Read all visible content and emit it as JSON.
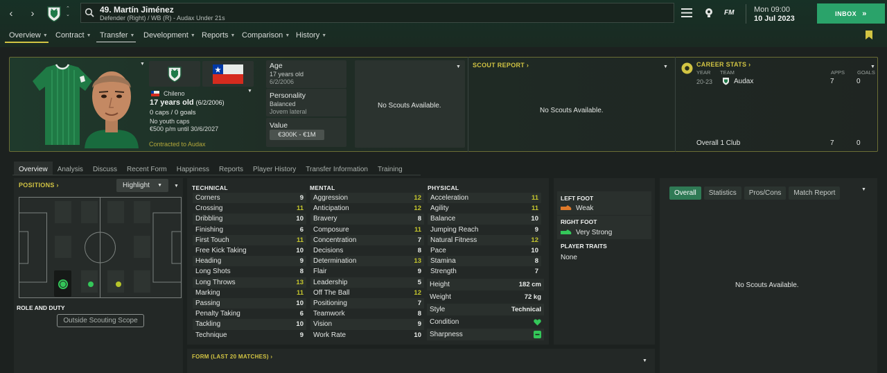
{
  "header": {
    "player_name": "49. Martín Jiménez",
    "player_sub": "Defender (Right) / WB (R) - Audax Under 21s",
    "date_day": "Mon 09:00",
    "date_full": "10 Jul 2023",
    "inbox_label": "INBOX",
    "fm_label": "FM"
  },
  "menu": {
    "items": [
      {
        "label": "Overview"
      },
      {
        "label": "Contract"
      },
      {
        "label": "Transfer"
      },
      {
        "label": "Development"
      },
      {
        "label": "Reports"
      },
      {
        "label": "Comparison"
      },
      {
        "label": "History"
      }
    ]
  },
  "profile": {
    "nationality": "Chileno",
    "age_line_bold": "17 years old",
    "age_line_rest": "(6/2/2006)",
    "caps": "0 caps / 0 goals",
    "youth_caps": "No youth caps",
    "wage": "€500 p/m until 30/6/2027",
    "contract": "Contracted to Audax",
    "age_label": "Age",
    "age_value": "17 years old",
    "dob": "6/2/2006",
    "personality_label": "Personality",
    "personality_value": "Balanced",
    "media": "Jovem lateral",
    "value_label": "Value",
    "value_range": "€300K - €1M",
    "no_scouts_1": "No Scouts Available.",
    "scout_report_label": "SCOUT REPORT",
    "no_scouts_2": "No Scouts Available."
  },
  "career": {
    "title": "CAREER STATS",
    "col_year": "YEAR",
    "col_team": "TEAM",
    "col_apps": "APPS",
    "col_goals": "GOALS",
    "row": {
      "year": "20-23",
      "team": "Audax",
      "apps": "7",
      "goals": "0"
    },
    "overall_label": "Overall 1 Club",
    "overall_apps": "7",
    "overall_goals": "0"
  },
  "subtabs": [
    "Overview",
    "Analysis",
    "Discuss",
    "Recent Form",
    "Happiness",
    "Reports",
    "Player History",
    "Transfer Information",
    "Training"
  ],
  "positions": {
    "title": "POSITIONS",
    "highlight": "Highlight",
    "role_duty": "ROLE AND DUTY",
    "scope_button": "Outside Scouting Scope",
    "colors": {
      "natural": "#34c759",
      "accomplished": "#34c759",
      "competent": "#b6c52a"
    }
  },
  "attributes": {
    "technical_title": "TECHNICAL",
    "mental_title": "MENTAL",
    "physical_title": "PHYSICAL",
    "technical": [
      {
        "name": "Corners",
        "value": "9"
      },
      {
        "name": "Crossing",
        "value": "11"
      },
      {
        "name": "Dribbling",
        "value": "10"
      },
      {
        "name": "Finishing",
        "value": "6"
      },
      {
        "name": "First Touch",
        "value": "11"
      },
      {
        "name": "Free Kick Taking",
        "value": "10"
      },
      {
        "name": "Heading",
        "value": "9"
      },
      {
        "name": "Long Shots",
        "value": "8"
      },
      {
        "name": "Long Throws",
        "value": "13"
      },
      {
        "name": "Marking",
        "value": "11"
      },
      {
        "name": "Passing",
        "value": "10"
      },
      {
        "name": "Penalty Taking",
        "value": "6"
      },
      {
        "name": "Tackling",
        "value": "10"
      },
      {
        "name": "Technique",
        "value": "9"
      }
    ],
    "mental": [
      {
        "name": "Aggression",
        "value": "12"
      },
      {
        "name": "Anticipation",
        "value": "12"
      },
      {
        "name": "Bravery",
        "value": "8"
      },
      {
        "name": "Composure",
        "value": "11"
      },
      {
        "name": "Concentration",
        "value": "7"
      },
      {
        "name": "Decisions",
        "value": "8"
      },
      {
        "name": "Determination",
        "value": "13"
      },
      {
        "name": "Flair",
        "value": "9"
      },
      {
        "name": "Leadership",
        "value": "5"
      },
      {
        "name": "Off The Ball",
        "value": "12"
      },
      {
        "name": "Positioning",
        "value": "7"
      },
      {
        "name": "Teamwork",
        "value": "8"
      },
      {
        "name": "Vision",
        "value": "9"
      },
      {
        "name": "Work Rate",
        "value": "10"
      }
    ],
    "physical": [
      {
        "name": "Acceleration",
        "value": "11"
      },
      {
        "name": "Agility",
        "value": "11"
      },
      {
        "name": "Balance",
        "value": "10"
      },
      {
        "name": "Jumping Reach",
        "value": "9"
      },
      {
        "name": "Natural Fitness",
        "value": "12"
      },
      {
        "name": "Pace",
        "value": "10"
      },
      {
        "name": "Stamina",
        "value": "8"
      },
      {
        "name": "Strength",
        "value": "7"
      }
    ],
    "height_label": "Height",
    "height_value": "182 cm",
    "weight_label": "Weight",
    "weight_value": "72 kg",
    "style_label": "Style",
    "style_value": "Technical",
    "condition_label": "Condition",
    "sharpness_label": "Sharpness",
    "form_title": "FORM (LAST 20 MATCHES)"
  },
  "feet": {
    "left_title": "LEFT FOOT",
    "left_value": "Weak",
    "right_title": "RIGHT FOOT",
    "right_value": "Very Strong",
    "traits_title": "PLAYER TRAITS",
    "traits_value": "None"
  },
  "report_panel": {
    "tabs": [
      "Overall",
      "Statistics",
      "Pros/Cons",
      "Match Report"
    ],
    "no_scouts": "No Scouts Available."
  },
  "colors": {
    "accent_green": "#2aa36a",
    "gold": "#d2c443",
    "value_yellow": "#c5c62d"
  }
}
